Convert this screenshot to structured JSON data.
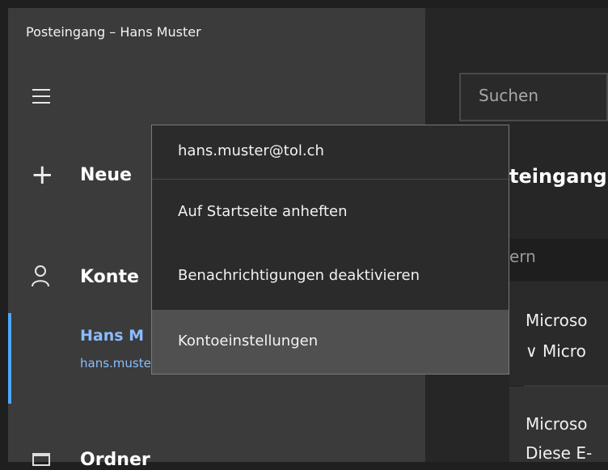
{
  "window": {
    "title": "Posteingang – Hans Muster"
  },
  "sidebar": {
    "new_mail_label": "Neue",
    "accounts_label": "Konte",
    "account_name": "Hans M",
    "account_email": "hans.muster@tol.ch",
    "folders_label": "Ordner"
  },
  "content": {
    "search_placeholder": "Suchen",
    "inbox_title": "teingang",
    "filter_label": "ern",
    "mails": [
      {
        "line1": "Microso",
        "line2": "∨ Micro"
      },
      {
        "line1": "Microso",
        "line2": "Diese E-"
      }
    ]
  },
  "context_menu": {
    "email": "hans.muster@tol.ch",
    "items": [
      "Auf Startseite anheften",
      "Benachrichtigungen deaktivieren",
      "Kontoeinstellungen"
    ],
    "highlighted_index": 2
  },
  "colors": {
    "accent": "#4ea6ff",
    "sidebar_bg": "#3b3b3b",
    "menu_bg": "#2b2b2b",
    "menu_highlight": "#505050"
  }
}
